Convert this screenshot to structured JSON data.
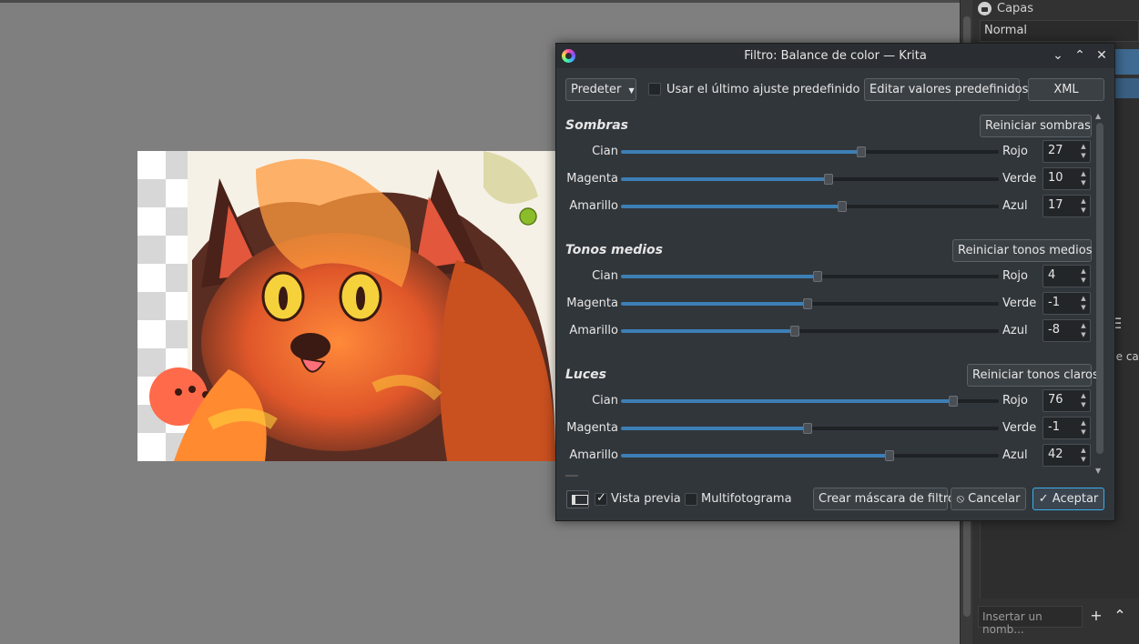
{
  "dialog": {
    "title": "Filtro: Balance de color — Krita",
    "preset_label": "Predeter",
    "use_last_label": "Usar el último ajuste predefinido",
    "use_last_checked": false,
    "edit_presets_label": "Editar valores predefinidos",
    "xml_label": "XML",
    "sections": [
      {
        "title": "Sombras",
        "reset_label": "Reiniciar sombras",
        "rows": [
          {
            "left": "Cian",
            "right": "Rojo",
            "value": "27",
            "level": 27
          },
          {
            "left": "Magenta",
            "right": "Verde",
            "value": "10",
            "level": 10
          },
          {
            "left": "Amarillo",
            "right": "Azul",
            "value": "17",
            "level": 17
          }
        ]
      },
      {
        "title": "Tonos medios",
        "reset_label": "Reiniciar tonos medios",
        "rows": [
          {
            "left": "Cian",
            "right": "Rojo",
            "value": "4",
            "level": 4
          },
          {
            "left": "Magenta",
            "right": "Verde",
            "value": "-1",
            "level": -1
          },
          {
            "left": "Amarillo",
            "right": "Azul",
            "value": "-8",
            "level": -8
          }
        ]
      },
      {
        "title": "Luces",
        "reset_label": "Reiniciar tonos claros",
        "rows": [
          {
            "left": "Cian",
            "right": "Rojo",
            "value": "76",
            "level": 76
          },
          {
            "left": "Magenta",
            "right": "Verde",
            "value": "-1",
            "level": -1
          },
          {
            "left": "Amarillo",
            "right": "Azul",
            "value": "42",
            "level": 42
          }
        ]
      }
    ],
    "preview_label": "Vista previa",
    "preview_checked": true,
    "multiframe_label": "Multifotograma",
    "multiframe_checked": false,
    "create_mask_label": "Crear máscara de filtro",
    "cancel_label": "Cancelar",
    "accept_label": "Aceptar"
  },
  "docker": {
    "title": "Capas",
    "blend_mode": "Normal",
    "partial_label": "de ca",
    "name_placeholder": "Insertar un nomb..."
  },
  "colors": {
    "accent": "#3daee9",
    "dialog_bg": "#31363b",
    "canvas_bg": "#7f7f7f",
    "slider_fill": "#3d7fb5"
  }
}
